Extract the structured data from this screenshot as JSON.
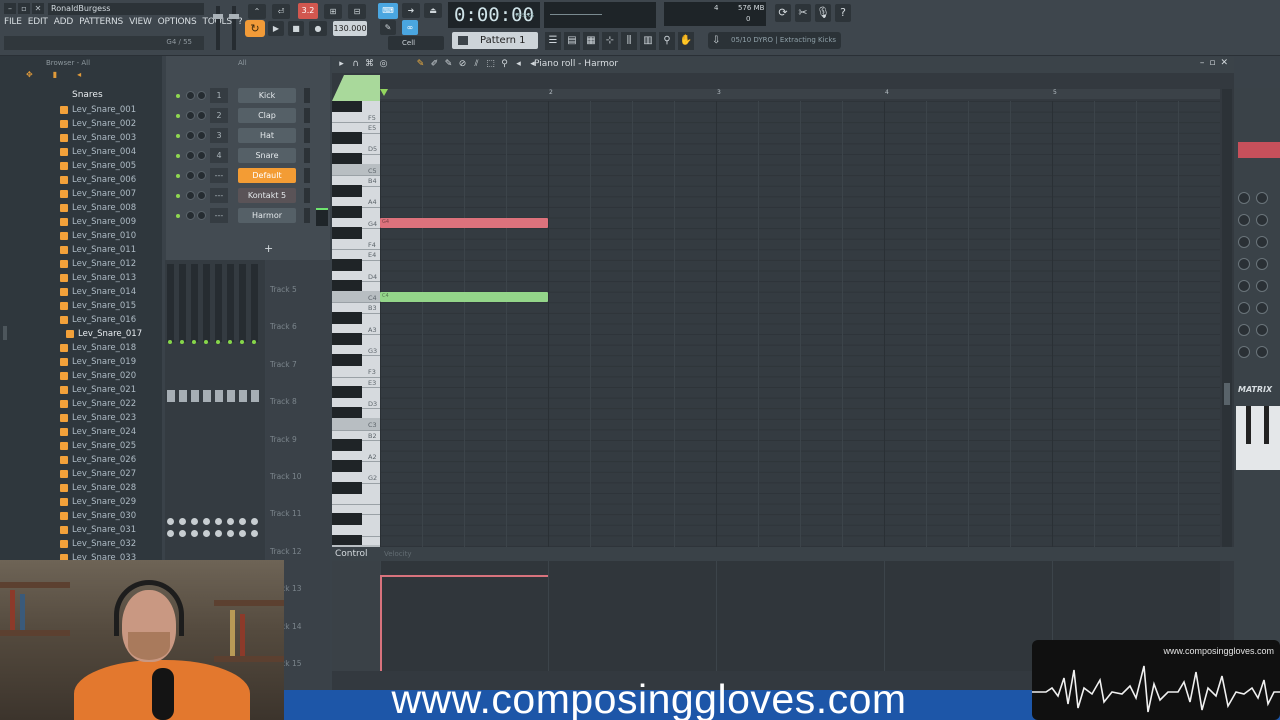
{
  "titlebar": {
    "user": "RonaldBurgess"
  },
  "menu": [
    "FILE",
    "EDIT",
    "ADD",
    "PATTERNS",
    "VIEW",
    "OPTIONS",
    "TOOLS",
    "?"
  ],
  "hint_text": "G4 / 55",
  "transport": {
    "time": "0:00:00",
    "time_unit": "M:S:CS",
    "tempo": "130.000",
    "song_mode": "3.2",
    "cpu": "4",
    "memory": "576 MB",
    "polyphony": "0",
    "pattern": "Pattern 1",
    "snap": "Cell",
    "hint_pill": "05/10  DYRO | Extracting Kicks"
  },
  "browser": {
    "header": "Browser - All",
    "folder": "Snares",
    "selected": "Lev_Snare_017",
    "files": [
      "Lev_Snare_001",
      "Lev_Snare_002",
      "Lev_Snare_003",
      "Lev_Snare_004",
      "Lev_Snare_005",
      "Lev_Snare_006",
      "Lev_Snare_007",
      "Lev_Snare_008",
      "Lev_Snare_009",
      "Lev_Snare_010",
      "Lev_Snare_011",
      "Lev_Snare_012",
      "Lev_Snare_013",
      "Lev_Snare_014",
      "Lev_Snare_015",
      "Lev_Snare_016",
      "Lev_Snare_017",
      "Lev_Snare_018",
      "Lev_Snare_019",
      "Lev_Snare_020",
      "Lev_Snare_021",
      "Lev_Snare_022",
      "Lev_Snare_023",
      "Lev_Snare_024",
      "Lev_Snare_025",
      "Lev_Snare_026",
      "Lev_Snare_027",
      "Lev_Snare_028",
      "Lev_Snare_029",
      "Lev_Snare_030",
      "Lev_Snare_031",
      "Lev_Snare_032",
      "Lev_Snare_033"
    ]
  },
  "channel_rack": {
    "filter": "All",
    "channels": [
      {
        "num": "1",
        "name": "Kick",
        "style": "normal"
      },
      {
        "num": "2",
        "name": "Clap",
        "style": "normal"
      },
      {
        "num": "3",
        "name": "Hat",
        "style": "normal"
      },
      {
        "num": "4",
        "name": "Snare",
        "style": "normal"
      },
      {
        "num": "---",
        "name": "Default",
        "style": "active"
      },
      {
        "num": "---",
        "name": "Kontakt 5",
        "style": "red"
      },
      {
        "num": "---",
        "name": "Harmor",
        "style": "normal"
      }
    ],
    "add_label": "+"
  },
  "tracks": [
    "Track 5",
    "Track 6",
    "Track 7",
    "Track 8",
    "Track 9",
    "Track 10",
    "Track 11",
    "Track 12",
    "Track 13",
    "Track 14",
    "Track 15"
  ],
  "piano_roll": {
    "title": "Piano roll - Harmor",
    "bars": [
      "2",
      "3",
      "4",
      "5"
    ],
    "key_labels": [
      "F5",
      "E5",
      "D5",
      "C5",
      "B4",
      "A4",
      "G4",
      "F4",
      "E4",
      "D4",
      "C4",
      "B3",
      "A3",
      "G3",
      "F3",
      "E3",
      "D3",
      "C3",
      "B2",
      "A2",
      "G2"
    ],
    "notes": [
      {
        "pitch": "G4",
        "label": "G4",
        "start": 0,
        "length": 1,
        "color": "#dd727c"
      },
      {
        "pitch": "C4",
        "label": "C4",
        "start": 0,
        "length": 1,
        "color": "#94d68a"
      }
    ],
    "control_label": "Control",
    "control_target": "Velocity"
  },
  "overlay": {
    "banner_url": "www.composinggloves.com",
    "badge_url": "www.composinggloves.com"
  },
  "right_panel": {
    "title": "MATRIX"
  },
  "colors": {
    "accent": "#f39c34",
    "note_red": "#dd727c",
    "note_green": "#94d68a",
    "banner": "#1d56a8"
  }
}
